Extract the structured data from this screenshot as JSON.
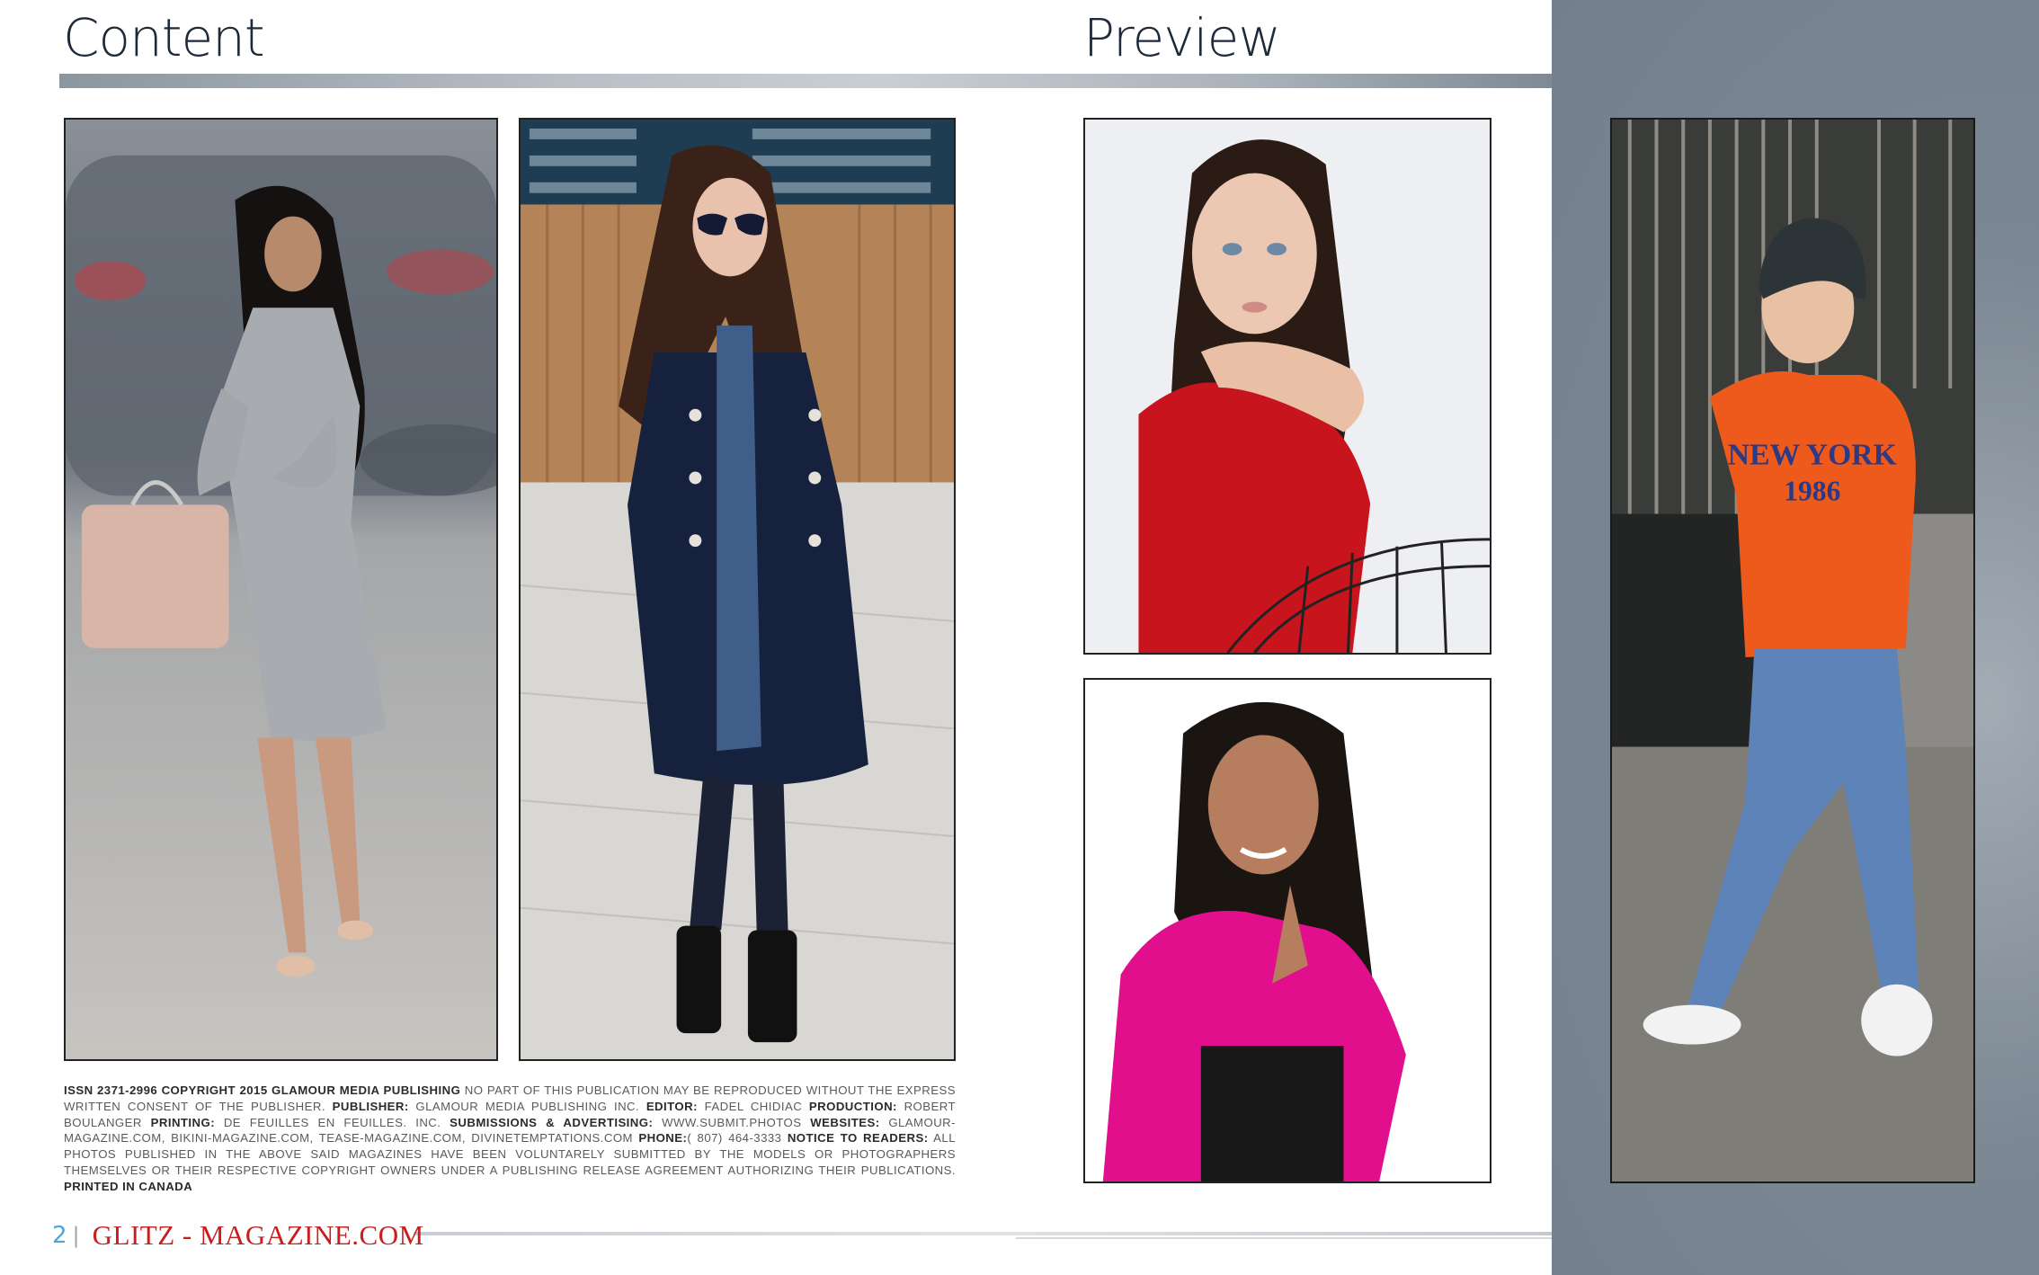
{
  "headings": {
    "content": "Content",
    "preview": "Preview"
  },
  "photos": [
    {
      "name": "woman-grey-sweater-dress-photo"
    },
    {
      "name": "girl-navy-coat-sunglasses-photo"
    },
    {
      "name": "girl-red-dress-portrait-photo"
    },
    {
      "name": "girl-pink-blouse-braids-photo"
    },
    {
      "name": "boy-orange-new-york-sweatshirt-photo"
    }
  ],
  "legal": {
    "issn": "ISSN 2371-2996 COPYRIGHT 2015 GLAMOUR MEDIA PUBLISHING",
    "issn_text": " NO PART OF THIS PUBLICATION MAY BE REPRODUCED WITHOUT THE EXPRESS WRITTEN CONSENT OF THE PUBLISHER. ",
    "publisher_label": "PUBLISHER:",
    "publisher_value": " GLAMOUR MEDIA PUBLISHING INC. ",
    "editor_label": "EDITOR:",
    "editor_value": " FADEL CHIDIAC ",
    "production_label": "PRODUCTION:",
    "production_value": " ROBERT BOULANGER ",
    "printing_label": "PRINTING:",
    "printing_value": " DE FEUILLES EN FEUILLES. INC. ",
    "submissions_label": "SUBMISSIONS & ADVERTISING:",
    "submissions_value": " WWW.SUBMIT.PHOTOS ",
    "websites_label": "WEBSITES:",
    "websites_value": " GLAMOUR-MAGAZINE.COM, BIKINI-MAGAZINE.COM, TEASE-MAGAZINE.COM, DIVINETEMPTATIONS.COM ",
    "phone_label": "PHONE:",
    "phone_value": "( 807) 464-3333 ",
    "notice_label": "NOTICE TO READERS:",
    "notice_value": " ALL PHOTOS PUBLISHED IN THE ABOVE SAID MAGAZINES HAVE BEEN VOLUNTARELY SUBMITTED BY THE MODELS OR PHOTOGRAPHERS THEMSELVES OR THEIR RESPECTIVE COPYRIGHT OWNERS UNDER A PUBLISHING RELEASE AGREEMENT AUTHORIZING THEIR PUBLICATIONS. ",
    "printed": "PRINTED IN CANADA"
  },
  "footer": {
    "page_number": "2",
    "separator": "|",
    "brand": "GLITZ - MAGAZINE.COM"
  },
  "sweatshirt_text": {
    "line1": "NEW YORK",
    "line2": "1986"
  },
  "colors": {
    "brand_red": "#c81e1e",
    "page_number_blue": "#4aa8d8",
    "panel_grey": "#7b8793"
  }
}
